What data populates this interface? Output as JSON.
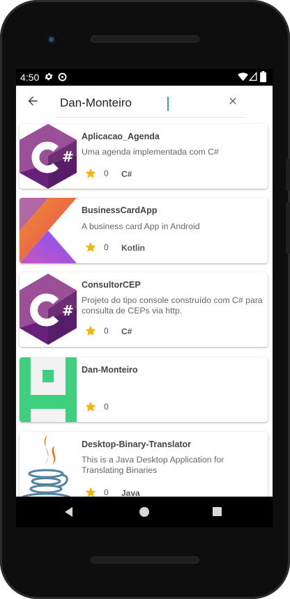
{
  "status": {
    "time": "4:50"
  },
  "search": {
    "value": "Dan-Monteiro"
  },
  "repos": [
    {
      "name": "Aplicacao_Agenda",
      "description": "Uma agenda implementada com C#",
      "stars": "0",
      "language": "C#"
    },
    {
      "name": "BusinessCardApp",
      "description": "A business card App in Android",
      "stars": "0",
      "language": "Kotlin"
    },
    {
      "name": "ConsultorCEP",
      "description": "Projeto do tipo console construído com C# para consulta de CEPs via http.",
      "stars": "0",
      "language": "C#"
    },
    {
      "name": "Dan-Monteiro",
      "description": "",
      "stars": "0",
      "language": ""
    },
    {
      "name": "Desktop-Binary-Translator",
      "description": "This is a Java Desktop Application for Translating Binaries",
      "stars": "0",
      "language": "Java"
    }
  ],
  "icons": {
    "back": "arrow-left-icon",
    "clear": "close-icon",
    "star": "star-icon",
    "nav": [
      "back-triangle-icon",
      "home-circle-icon",
      "recents-square-icon"
    ]
  },
  "colors": {
    "star": "#f4b400",
    "csharp": "#68217a",
    "kotlin_orange": "#f18e33",
    "kotlin_purple": "#7f52ff",
    "avatar": "#3fd07f"
  }
}
